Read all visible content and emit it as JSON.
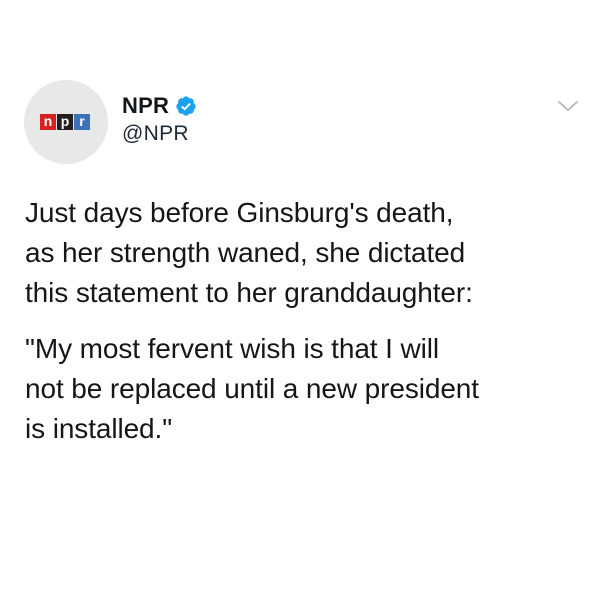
{
  "avatar": {
    "logo_letters": [
      "n",
      "p",
      "r"
    ],
    "logo_colors": [
      "#d62021",
      "#231f20",
      "#3b73b9"
    ],
    "background": "#e8e8e8"
  },
  "author": {
    "display_name": "NPR",
    "handle": "@NPR",
    "verified": true,
    "verified_icon": "verified-badge-icon",
    "verified_color": "#1da1f2"
  },
  "menu": {
    "icon": "chevron-down-icon"
  },
  "tweet": {
    "paragraph_1": "Just days before Ginsburg's death,\nas her strength waned, she dictated\nthis statement to her granddaughter:",
    "paragraph_2": "\"My most fervent wish is that I will\nnot be replaced until a new president\nis installed.\""
  }
}
